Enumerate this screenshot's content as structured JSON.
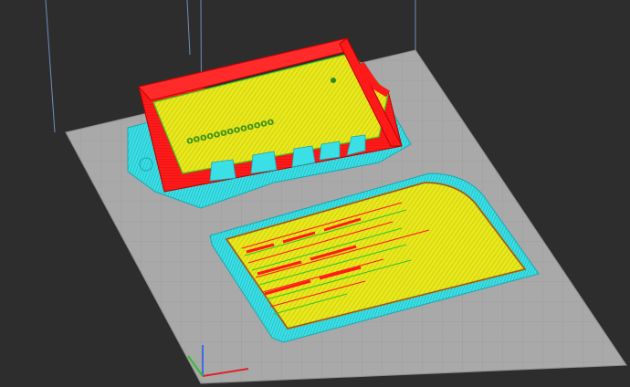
{
  "viewer": {
    "view": "layer-preview-3d",
    "colors": {
      "background": "#2d2d2d",
      "build_plate": "#a9a9a9",
      "plate_grid": "#8f8f8f",
      "build_volume_lines": "#6f8fbf",
      "perimeter_outer": "#ff1a1a",
      "perimeter_inner": "#39c424",
      "infill": "#e8e81c",
      "skirt_brim": "#3be0e6",
      "support": "#2bd3d8",
      "axis_x": "#e0202a",
      "axis_y": "#2ec12e",
      "axis_z": "#3b6fe0"
    },
    "objects": [
      {
        "name": "enclosure-box",
        "features": [
          "perimeters",
          "infill",
          "brim",
          "cutouts"
        ]
      },
      {
        "name": "lid-plate",
        "features": [
          "perimeters",
          "infill",
          "brim",
          "text-pattern"
        ]
      }
    ],
    "axes": [
      "x-axis-icon",
      "y-axis-icon",
      "z-axis-icon"
    ]
  }
}
